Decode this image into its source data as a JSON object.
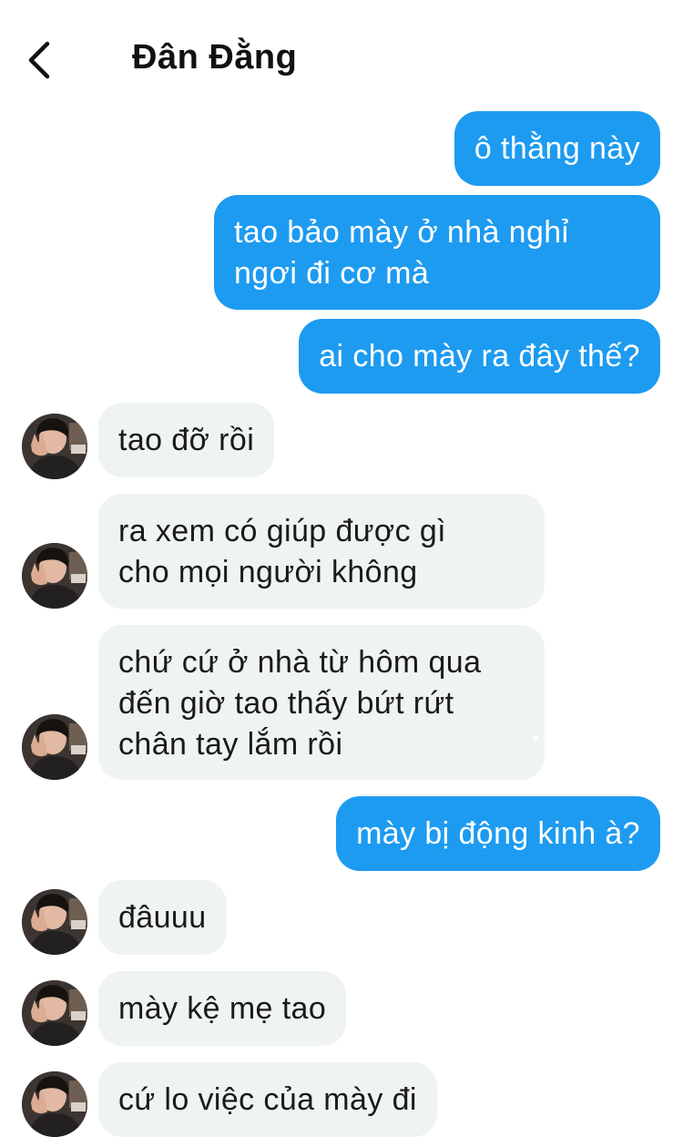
{
  "header": {
    "title": "Đân Đằng",
    "back_icon": "chevron-left-icon"
  },
  "messages": [
    {
      "side": "out",
      "text": "ô thằng này"
    },
    {
      "side": "out",
      "text": "tao bảo mày ở nhà nghỉ\nngơi đi cơ mà"
    },
    {
      "side": "out",
      "text": "ai cho mày ra đây thế?"
    },
    {
      "side": "in",
      "text": "tao đỡ rồi"
    },
    {
      "side": "in",
      "text": "ra xem có giúp được gì\ncho mọi người không"
    },
    {
      "side": "in",
      "text": "chứ cứ ở nhà từ hôm qua\nđến giờ tao thấy bứt rứt\nchân tay lắm rồi"
    },
    {
      "side": "out",
      "text": "mày bị động kinh à?"
    },
    {
      "side": "in",
      "text": "đâuuu"
    },
    {
      "side": "in",
      "text": "mày kệ mẹ tao"
    },
    {
      "side": "in",
      "text": "cứ lo việc của mày đi"
    }
  ],
  "colors": {
    "outgoing_bubble": "#1d9bf0",
    "incoming_bubble": "#eff3f4",
    "outgoing_text": "#ffffff",
    "incoming_text": "#1a1a1a"
  }
}
